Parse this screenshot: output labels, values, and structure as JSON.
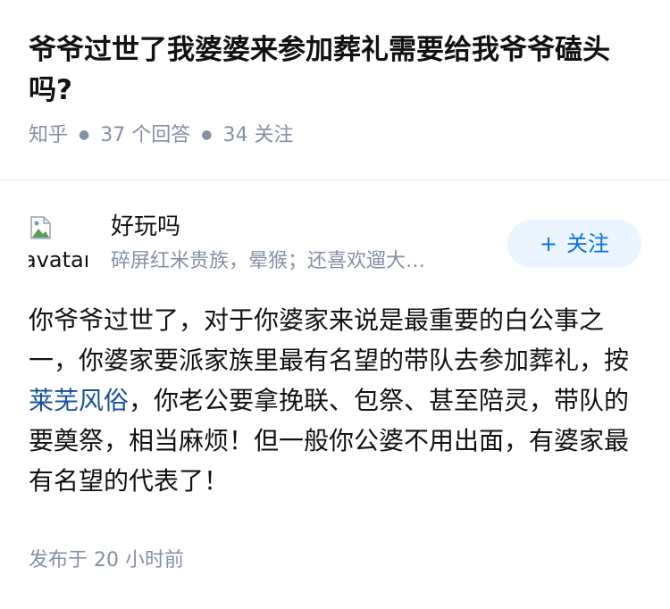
{
  "question": {
    "title": "爷爷过世了我婆婆来参加葬礼需要给我爷爷磕头吗?",
    "source": "知乎",
    "answer_count": "37 个回答",
    "follower_count": "34 关注"
  },
  "author": {
    "avatar_alt": "avatar",
    "name": "好玩吗",
    "bio": "碎屏红米贵族，晕猴；还喜欢遛大…",
    "follow_label": "关注",
    "follow_plus": "+"
  },
  "answer": {
    "text_before_link": "你爷爷过世了，对于你婆家来说是最重要的白公事之一，你婆家要派家族里最有名望的带队去参加葬礼，按",
    "link_text": "莱芜风俗",
    "text_after_link": "，你老公要拿挽联、包祭、甚至陪灵，带队的要奠祭，相当麻烦！但一般你公婆不用出面，有婆家最有名望的代表了！",
    "publish_time": "发布于 20 小时前"
  },
  "colors": {
    "meta_gray": "#8590a6",
    "link_blue": "#175199",
    "follow_text": "#056de8",
    "follow_bg": "#ebf5ff"
  }
}
